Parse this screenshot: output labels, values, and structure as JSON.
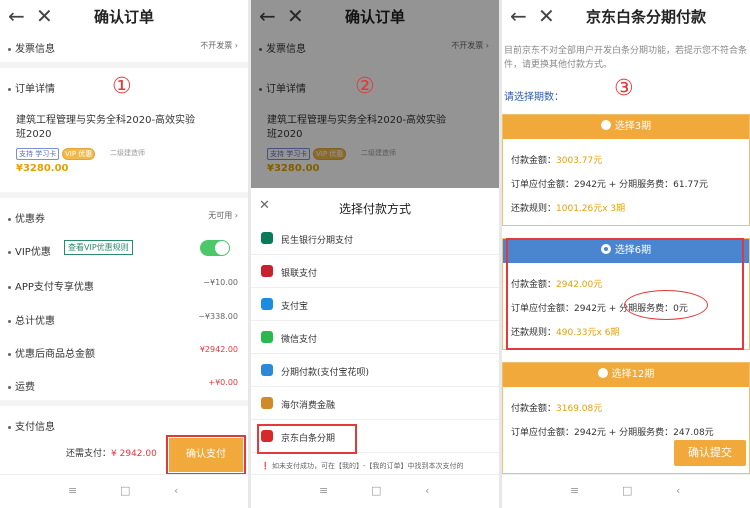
{
  "screen1": {
    "title": "确认订单",
    "marker": "①",
    "invoice_label": "发票信息",
    "invoice_value": "不开发票 ›",
    "order_label": "订单详情",
    "product_name": "建筑工程管理与实务全科2020-高效实验班2020",
    "tag_support": "支持 学习卡",
    "tag_vip": "VIP 优惠",
    "tag_level": "二级建造师",
    "price": "¥3280.00",
    "coupon_label": "优惠券",
    "coupon_value": "无可用 ›",
    "vip_label": "VIP优惠",
    "vip_rule": "查看VIP优惠规则",
    "app_label": "APP支付专享优惠",
    "app_value": "−¥10.00",
    "total_discount_label": "总计优惠",
    "total_discount_value": "−¥338.00",
    "after_discount_label": "优惠后商品总金额",
    "after_discount_value": "¥2942.00",
    "shipping_label": "运费",
    "shipping_value": "+¥0.00",
    "payinfo_label": "支付信息",
    "due_label": "还需支付：",
    "due_value": "¥ 2942.00",
    "confirm_pay": "确认支付"
  },
  "screen2": {
    "title": "确认订单",
    "marker": "②",
    "sheet_title": "选择付款方式",
    "methods": [
      {
        "label": "民生银行分期支付",
        "color": "#0b7a5a"
      },
      {
        "label": "银联支付",
        "color": "#c8202e"
      },
      {
        "label": "支付宝",
        "color": "#1c8ce0"
      },
      {
        "label": "微信支付",
        "color": "#2bb84f"
      },
      {
        "label": "分期付款(支付宝花呗)",
        "color": "#2a8ad8"
      },
      {
        "label": "海尔消费金融",
        "color": "#d18a2a"
      },
      {
        "label": "京东白条分期",
        "color": "#d62a2a"
      }
    ],
    "note": "如未支付成功，可在【我的】-【我的订单】中找到本次支付的"
  },
  "screen3": {
    "title": "京东白条分期付款",
    "marker": "③",
    "info": "目前京东不对全部用户开发白条分期功能，若提示您不符合条件，请更换其他付款方式。",
    "choose": "请选择期数：",
    "plans": [
      {
        "label": "选择3期",
        "amount": "3003.77元",
        "order": "2942元 + 分期服务费：61.77元",
        "rule": "1001.26元x 3期"
      },
      {
        "label": "选择6期",
        "amount": "2942.00元",
        "order": "2942元 + 分期服务费：0元",
        "rule": "490.33元x 6期"
      },
      {
        "label": "选择12期",
        "amount": "3169.08元",
        "order": "2942元 + 分期服务费：247.08元",
        "rule": ""
      }
    ],
    "amount_label": "付款金额：",
    "order_label": "订单应付金额：",
    "rule_label": "还款规则：",
    "submit": "确认提交"
  },
  "nav": {
    "menu": "≡",
    "home": "□",
    "back": "‹"
  }
}
